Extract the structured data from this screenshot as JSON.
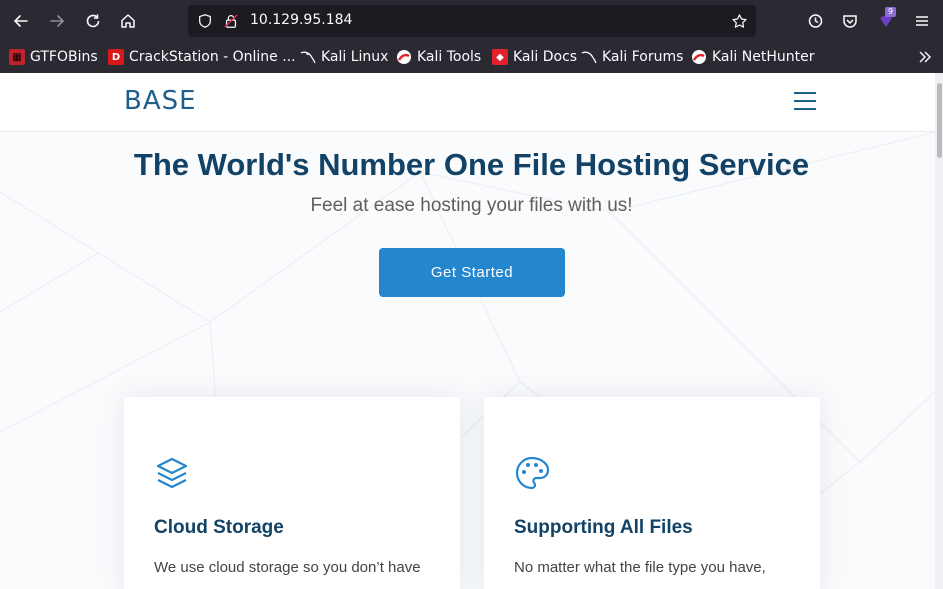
{
  "browser": {
    "url": "10.129.95.184",
    "extension_badge": "9",
    "bookmarks": [
      {
        "label": "GTFOBins",
        "icon": "gtfobins-icon"
      },
      {
        "label": "CrackStation - Online ...",
        "icon": "crackstation-icon"
      },
      {
        "label": "Kali Linux",
        "icon": "kali-dragon-icon"
      },
      {
        "label": "Kali Tools",
        "icon": "kali-tools-icon"
      },
      {
        "label": "Kali Docs",
        "icon": "kali-docs-icon"
      },
      {
        "label": "Kali Forums",
        "icon": "kali-forums-icon"
      },
      {
        "label": "Kali NetHunter",
        "icon": "kali-nethunter-icon"
      }
    ]
  },
  "site": {
    "logo": "BASE",
    "hero": {
      "title": "The World's Number One File Hosting Service",
      "subtitle": "Feel at ease hosting your files with us!",
      "cta_label": "Get Started"
    },
    "cards": [
      {
        "title": "Cloud Storage",
        "text": "We use cloud storage so you don’t have",
        "icon": "layers-icon"
      },
      {
        "title": "Supporting All Files",
        "text": "No matter what the file type you have,",
        "icon": "palette-icon"
      }
    ]
  },
  "colors": {
    "chrome_bg": "#2b2a33",
    "urlbar_bg": "#1c1b22",
    "accent": "#2487ce",
    "heading": "#124265",
    "logo": "#1f5f8c"
  }
}
